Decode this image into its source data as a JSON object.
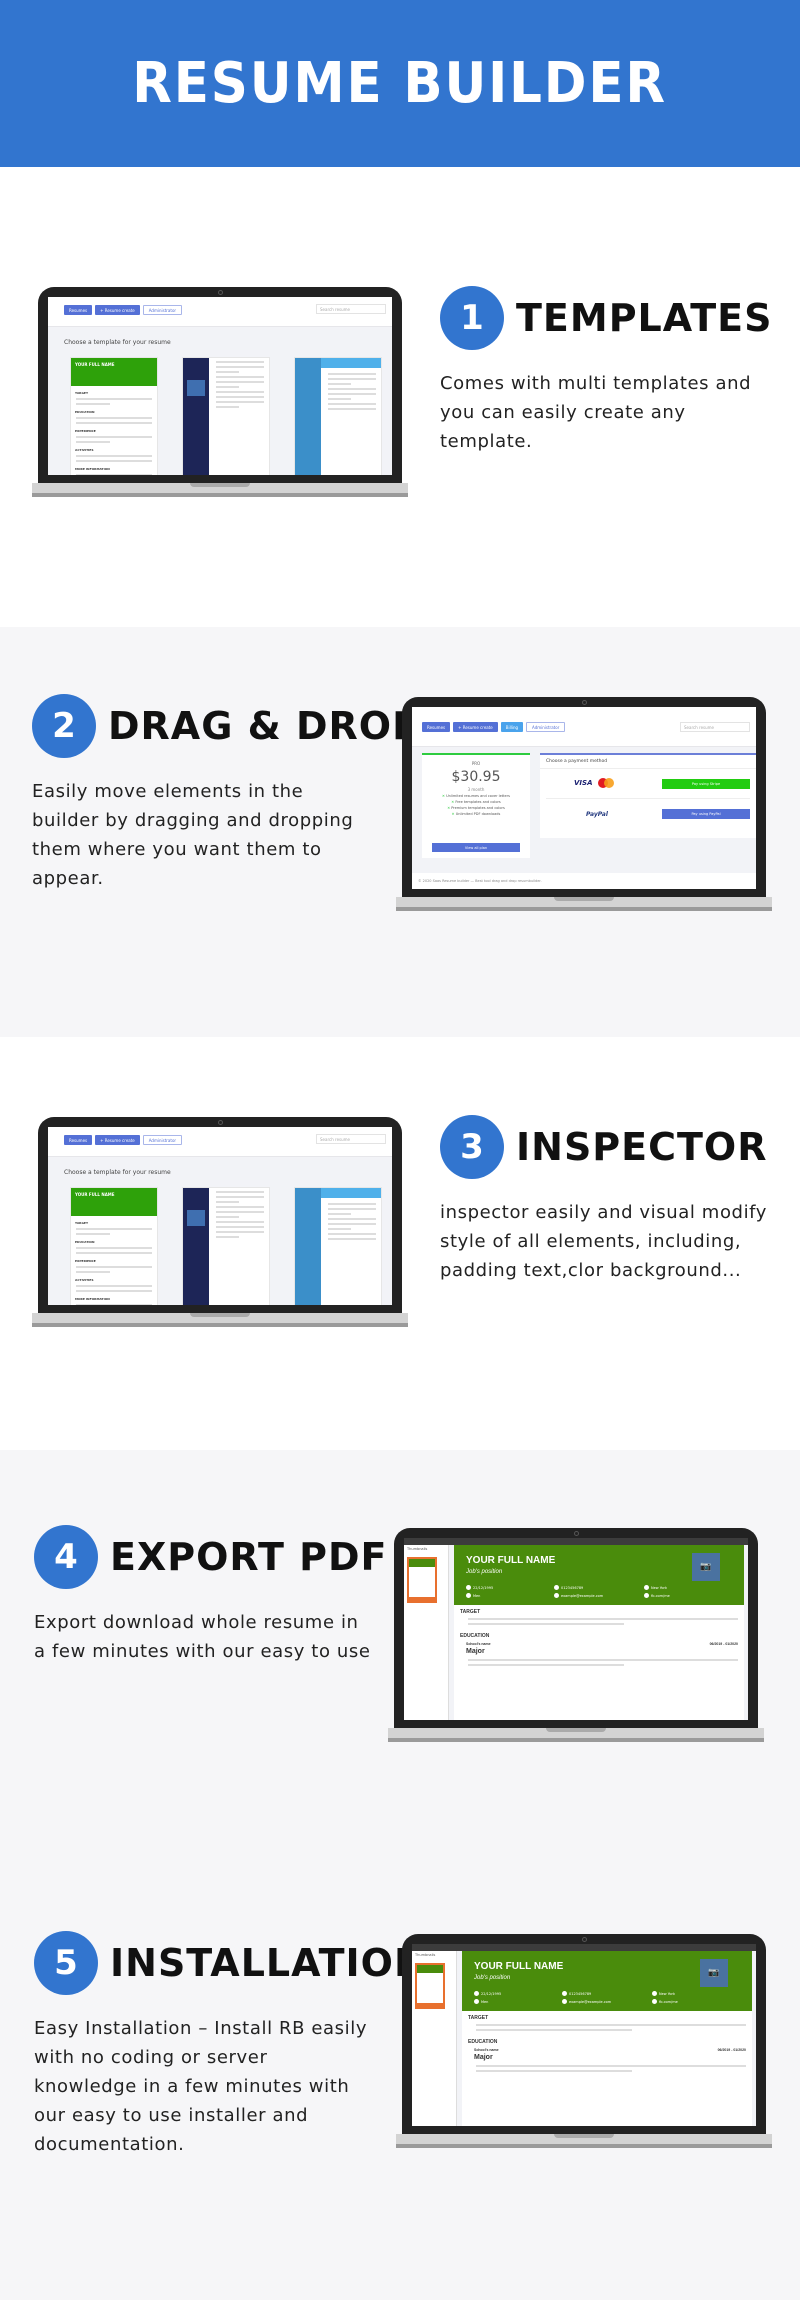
{
  "header": {
    "title": "RESUME BUILDER"
  },
  "colors": {
    "brand_blue": "#3275cf",
    "section_gray": "#f6f6f8",
    "resume_green": "#4a8c0c",
    "template_green": "#2ea10a",
    "template_navy": "#1d2557",
    "template_blue": "#3b8fc9"
  },
  "features": [
    {
      "number": "1",
      "title": "TEMPLATES",
      "description": "Comes with multi templates and you can easily create any template."
    },
    {
      "number": "2",
      "title": "DRAG & DROP",
      "description": "Easily move elements in the builder by dragging and dropping them where you want them to appear."
    },
    {
      "number": "3",
      "title": "INSPECTOR",
      "description": "inspector easily and visual modify style of all elements, including, padding text,clor background..."
    },
    {
      "number": "4",
      "title": "EXPORT PDF",
      "description": "Export download whole resume in a few minutes with our easy to use"
    },
    {
      "number": "5",
      "title": "INSTALLATION",
      "description": "Easy Installation – Install RB easily with no coding or server knowledge in a few minutes with our easy to use installer and documentation."
    }
  ],
  "app": {
    "nav": {
      "resumes": "Resumes",
      "resume_create": "+ Resume create",
      "billing": "Billing",
      "administrator": "Administrator"
    },
    "search_placeholder": "Search resume",
    "choose_template": "Choose a template for your resume",
    "template_name": "YOUR FULL NAME",
    "template_section_labels": [
      "TARGET",
      "EDUCATION",
      "EXPERIENCE",
      "ACTIVITIES",
      "MORE INFORMATION"
    ]
  },
  "billing": {
    "plan": "PRO",
    "price": "$30.95",
    "period": "3 month",
    "features": [
      "Unlimited resumes and cover letters",
      "Free templates and colors",
      "Premium templates and colors",
      "Unlimited PDF downloads"
    ],
    "view_all": "View all plan",
    "payment_heading": "Choose a payment method",
    "visa": "VISA",
    "paypal": "PayPal",
    "pay_stripe": "Pay using Stripe",
    "pay_paypal": "Pay using PayPal",
    "footer": "© 2020 Saas Resume builder — Best tool drag and drop resumbuilder."
  },
  "resume": {
    "thumbnails_label": "Thumbnails",
    "name": "YOUR FULL NAME",
    "position": "Job's position",
    "info": [
      "22/12/1995",
      "0123456789",
      "New York",
      "Men",
      "example@example.com",
      "fb.com/me"
    ],
    "sections": [
      "TARGET",
      "EDUCATION"
    ],
    "school": "School's name",
    "dates": "06/2019 - 01/2020",
    "major": "Major"
  }
}
